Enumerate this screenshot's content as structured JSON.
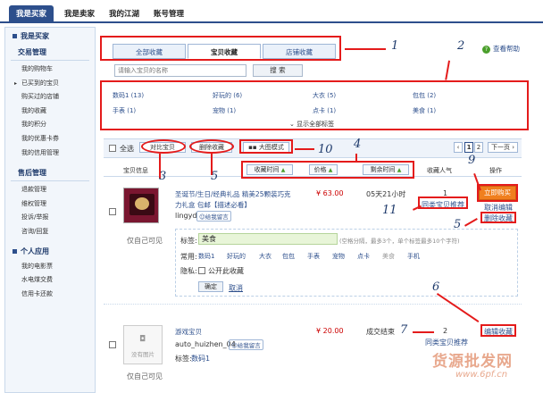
{
  "topnav": {
    "tabs": [
      "我是买家",
      "我是卖家",
      "我的江湖",
      "账号管理"
    ]
  },
  "sidebar": {
    "g1": "我是买家",
    "g1sub": "交易管理",
    "g1items": [
      "我的购物车",
      "已买到的宝贝",
      "购买过的店铺",
      "我的收藏",
      "我的积分",
      "我的优惠卡券",
      "我的信用管理"
    ],
    "g2": "售后管理",
    "g2items": [
      "退款管理",
      "维权管理",
      "投诉/举报",
      "咨询/回复"
    ],
    "g3": "个人应用",
    "g3items": [
      "我的电影票",
      "水电煤交费",
      "信用卡还款"
    ]
  },
  "tabs": {
    "all": "全部收藏",
    "items": "宝贝收藏",
    "shops": "店铺收藏",
    "help": "查看帮助"
  },
  "search": {
    "placeholder": "请输入宝贝的名称",
    "button": "搜 索"
  },
  "tags": {
    "row1": [
      "数码1 (13)",
      "好玩的 (6)",
      "大衣 (5)",
      "包包 (2)"
    ],
    "row2": [
      "手表 (1)",
      "宠物 (1)",
      "点卡 (1)",
      "美食 (1)"
    ],
    "showall": "显示全部标签"
  },
  "toolbar": {
    "selectall": "全选",
    "compare": "对比宝贝",
    "delete": "删除收藏",
    "bigview": "大图模式",
    "page1": "1",
    "page2": "2",
    "next": "下一页"
  },
  "header": {
    "info": "宝贝信息",
    "time": "收藏时间",
    "price": "价格",
    "remain": "剩余时间",
    "popularity": "收藏人气",
    "ops": "操作"
  },
  "item1": {
    "title1": "圣诞节/生日/经典礼品 精美25颗装巧克",
    "title2": "力礼盒 包邮【描述必看】",
    "seller": "lingyd",
    "wangwang": "给我留言",
    "visibility": "仅自己可见",
    "price": "¥ 63.00",
    "remain": "05天21小时",
    "pop": "1",
    "similar": "同类宝贝推荐",
    "buy": "立即购买",
    "cancel": "取消编辑",
    "delete": "删除收藏",
    "tag_label": "标签:",
    "tag_value": "美食",
    "tag_hint": "(空格分隔，最多3个，单个标签最多10个字符)",
    "common_label": "常用:",
    "common_tags": [
      "数码1",
      "好玩的",
      "大衣",
      "包包",
      "手表",
      "宠物",
      "点卡",
      "美食",
      "手机"
    ],
    "privacy_label": "隐私:",
    "public": "公开此收藏",
    "confirm": "确定",
    "cancel_link": "取消"
  },
  "item2": {
    "title": "游戏宝贝",
    "seller": "auto_huizhen_04",
    "wangwang": "给我留言",
    "tag": "标签:",
    "tagval": "数码1",
    "noimg": "没有图片",
    "visibility": "仅自己可见",
    "price": "¥ 20.00",
    "status": "成交结束",
    "pop": "2",
    "similar": "同类宝贝推荐",
    "edit": "编辑收藏"
  },
  "annotations": [
    "1",
    "2",
    "3",
    "4",
    "5",
    "6",
    "7",
    "9",
    "10",
    "11",
    "5"
  ],
  "watermark": {
    "cn": "货源批发网",
    "url": "www.6pf.cn"
  }
}
